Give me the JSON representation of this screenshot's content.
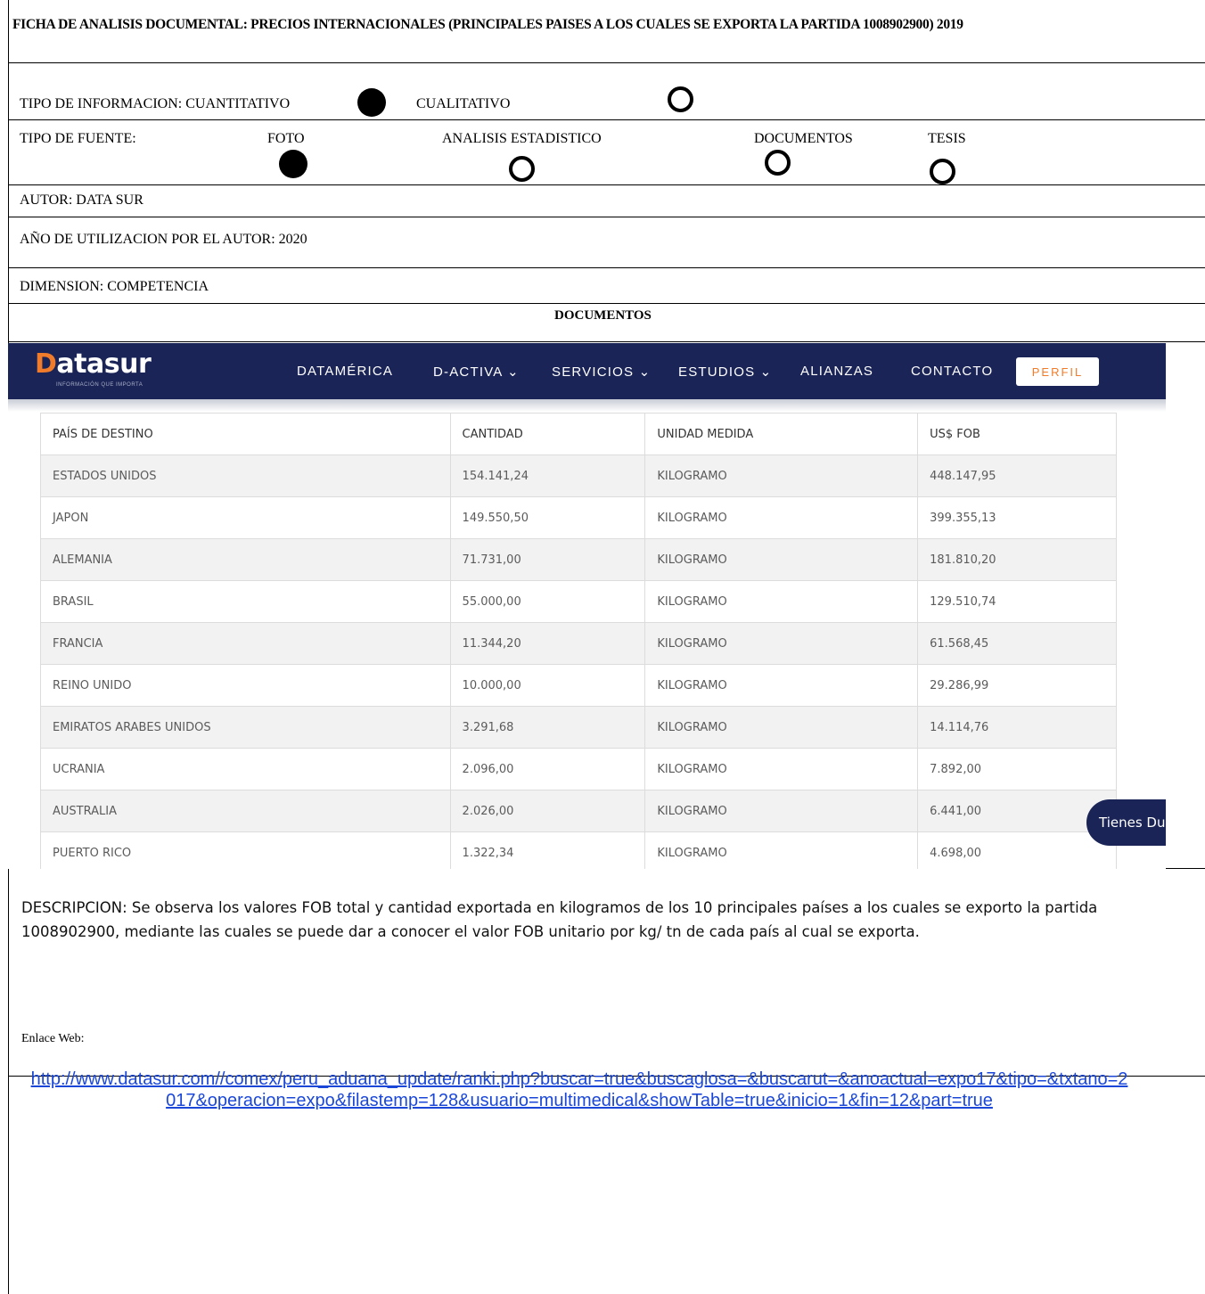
{
  "header": {
    "title": "FICHA DE ANALISIS DOCUMENTAL: PRECIOS INTERNACIONALES (PRINCIPALES PAISES A LOS CUALES SE EXPORTA LA PARTIDA 1008902900) 2019"
  },
  "tipo_informacion": {
    "label": "TIPO DE INFORMACION: CUANTITATIVO",
    "cualitativo": "CUALITATIVO"
  },
  "tipo_fuente": {
    "label": "TIPO DE FUENTE:",
    "foto": "FOTO",
    "analisis": "ANALISIS ESTADISTICO",
    "documentos": "DOCUMENTOS",
    "tesis": "TESIS"
  },
  "autor": "AUTOR: DATA SUR",
  "anio": "AÑO DE UTILIZACION POR EL AUTOR: 2020",
  "dimension": "DIMENSION: COMPETENCIA",
  "documentos_title": "DOCUMENTOS",
  "site": {
    "logo": "atasur",
    "logo_initial": "D",
    "logo_sub": "INFORMACIÓN QUE IMPORTA",
    "nav": [
      "DATAMÉRICA",
      "D-ACTIVA ⌄",
      "SERVICIOS ⌄",
      "ESTUDIOS ⌄",
      "ALIANZAS",
      "CONTACTO"
    ],
    "perfil": "PERFIL",
    "chat": "Tienes Du"
  },
  "table": {
    "headers": [
      "PAÍS DE DESTINO",
      "CANTIDAD",
      "UNIDAD MEDIDA",
      "US$ FOB"
    ],
    "rows": [
      [
        "ESTADOS UNIDOS",
        "154.141,24",
        "KILOGRAMO",
        "448.147,95"
      ],
      [
        "JAPON",
        "149.550,50",
        "KILOGRAMO",
        "399.355,13"
      ],
      [
        "ALEMANIA",
        "71.731,00",
        "KILOGRAMO",
        "181.810,20"
      ],
      [
        "BRASIL",
        "55.000,00",
        "KILOGRAMO",
        "129.510,74"
      ],
      [
        "FRANCIA",
        "11.344,20",
        "KILOGRAMO",
        "61.568,45"
      ],
      [
        "REINO UNIDO",
        "10.000,00",
        "KILOGRAMO",
        "29.286,99"
      ],
      [
        "EMIRATOS ARABES UNIDOS",
        "3.291,68",
        "KILOGRAMO",
        "14.114,76"
      ],
      [
        "UCRANIA",
        "2.096,00",
        "KILOGRAMO",
        "7.892,00"
      ],
      [
        "AUSTRALIA",
        "2.026,00",
        "KILOGRAMO",
        "6.441,00"
      ],
      [
        "PUERTO RICO",
        "1.322,34",
        "KILOGRAMO",
        "4.698,00"
      ]
    ]
  },
  "descripcion": "DESCRIPCION: Se observa los valores FOB total y cantidad exportada en kilogramos de los 10 principales países a los cuales se exporto la partida 1008902900, mediante las cuales se puede dar a conocer el valor FOB unitario por kg/ tn de cada país al cual se exporta.",
  "enlace_label": "Enlace Web:",
  "enlace_url": "http://www.datasur.com//comex/peru_aduana_update/ranki.php?buscar=true&buscaglosa=&buscarut=&anoactual=expo17&tipo=&txtano=2017&operacion=expo&filastemp=128&usuario=multimedical&showTable=true&inicio=1&fin=12&part=true"
}
